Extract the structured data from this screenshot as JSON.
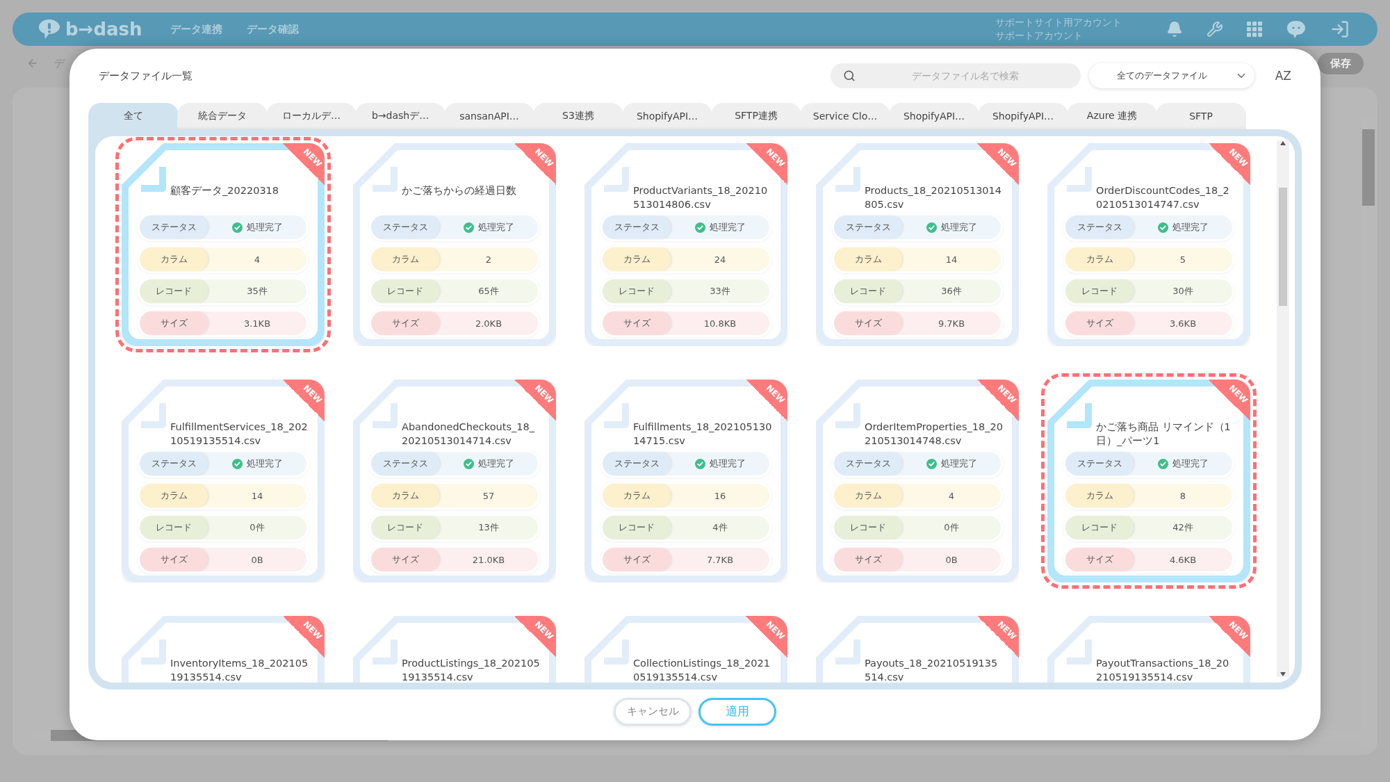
{
  "header": {
    "logo": "b→dash",
    "nav": [
      "データ連携",
      "データ確認"
    ],
    "account": [
      "サポートサイト用アカウント",
      "サポートアカウント"
    ]
  },
  "subbar": {
    "breadcrumb": "デ",
    "save": "保存"
  },
  "modal": {
    "title": "データファイル一覧",
    "search": {
      "placeholder": "データファイル名で検索"
    },
    "filter": {
      "value": "全てのデータファイル"
    },
    "sort": "AZ",
    "tabs": [
      {
        "label": "全て",
        "selected": true
      },
      {
        "label": "統合データ",
        "selected": false
      },
      {
        "label": "ローカルデ…",
        "selected": false
      },
      {
        "label": "b→dashデ…",
        "selected": false
      },
      {
        "label": "sansanAPI…",
        "selected": false
      },
      {
        "label": "S3連携",
        "selected": false
      },
      {
        "label": "ShopifyAPI…",
        "selected": false
      },
      {
        "label": "SFTP連携",
        "selected": false
      },
      {
        "label": "Service Clo…",
        "selected": false
      },
      {
        "label": "ShopifyAPI…",
        "selected": false
      },
      {
        "label": "ShopifyAPI…",
        "selected": false
      },
      {
        "label": "Azure 連携",
        "selected": false
      },
      {
        "label": "SFTP",
        "selected": false
      }
    ],
    "cards": [
      {
        "name": "顧客データ_20220318",
        "badge": "NEW",
        "selected": true,
        "stats": [
          {
            "kind": "status",
            "label": "ステータス",
            "value": "処理完了"
          },
          {
            "kind": "column",
            "label": "カラム",
            "value": "4"
          },
          {
            "kind": "record",
            "label": "レコード",
            "value": "35件"
          },
          {
            "kind": "size",
            "label": "サイズ",
            "value": "3.1KB"
          }
        ]
      },
      {
        "name": "かご落ちからの経過日数",
        "badge": "NEW",
        "selected": false,
        "stats": [
          {
            "kind": "status",
            "label": "ステータス",
            "value": "処理完了"
          },
          {
            "kind": "column",
            "label": "カラム",
            "value": "2"
          },
          {
            "kind": "record",
            "label": "レコード",
            "value": "65件"
          },
          {
            "kind": "size",
            "label": "サイズ",
            "value": "2.0KB"
          }
        ]
      },
      {
        "name": "ProductVariants_18_20210513014806.csv",
        "badge": "NEW",
        "selected": false,
        "stats": [
          {
            "kind": "status",
            "label": "ステータス",
            "value": "処理完了"
          },
          {
            "kind": "column",
            "label": "カラム",
            "value": "24"
          },
          {
            "kind": "record",
            "label": "レコード",
            "value": "33件"
          },
          {
            "kind": "size",
            "label": "サイズ",
            "value": "10.8KB"
          }
        ]
      },
      {
        "name": "Products_18_20210513014805.csv",
        "badge": "NEW",
        "selected": false,
        "stats": [
          {
            "kind": "status",
            "label": "ステータス",
            "value": "処理完了"
          },
          {
            "kind": "column",
            "label": "カラム",
            "value": "14"
          },
          {
            "kind": "record",
            "label": "レコード",
            "value": "36件"
          },
          {
            "kind": "size",
            "label": "サイズ",
            "value": "9.7KB"
          }
        ]
      },
      {
        "name": "OrderDiscountCodes_18_20210513014747.csv",
        "badge": "NEW",
        "selected": false,
        "stats": [
          {
            "kind": "status",
            "label": "ステータス",
            "value": "処理完了"
          },
          {
            "kind": "column",
            "label": "カラム",
            "value": "5"
          },
          {
            "kind": "record",
            "label": "レコード",
            "value": "30件"
          },
          {
            "kind": "size",
            "label": "サイズ",
            "value": "3.6KB"
          }
        ]
      },
      {
        "name": "FulfillmentServices_18_20210519135514.csv",
        "badge": "NEW",
        "selected": false,
        "stats": [
          {
            "kind": "status",
            "label": "ステータス",
            "value": "処理完了"
          },
          {
            "kind": "column",
            "label": "カラム",
            "value": "14"
          },
          {
            "kind": "record",
            "label": "レコード",
            "value": "0件"
          },
          {
            "kind": "size",
            "label": "サイズ",
            "value": "0B"
          }
        ]
      },
      {
        "name": "AbandonedCheckouts_18_20210513014714.csv",
        "badge": "NEW",
        "selected": false,
        "stats": [
          {
            "kind": "status",
            "label": "ステータス",
            "value": "処理完了"
          },
          {
            "kind": "column",
            "label": "カラム",
            "value": "57"
          },
          {
            "kind": "record",
            "label": "レコード",
            "value": "13件"
          },
          {
            "kind": "size",
            "label": "サイズ",
            "value": "21.0KB"
          }
        ]
      },
      {
        "name": "Fulfillments_18_20210513014715.csv",
        "badge": "NEW",
        "selected": false,
        "stats": [
          {
            "kind": "status",
            "label": "ステータス",
            "value": "処理完了"
          },
          {
            "kind": "column",
            "label": "カラム",
            "value": "16"
          },
          {
            "kind": "record",
            "label": "レコード",
            "value": "4件"
          },
          {
            "kind": "size",
            "label": "サイズ",
            "value": "7.7KB"
          }
        ]
      },
      {
        "name": "OrderItemProperties_18_20210513014748.csv",
        "badge": "NEW",
        "selected": false,
        "stats": [
          {
            "kind": "status",
            "label": "ステータス",
            "value": "処理完了"
          },
          {
            "kind": "column",
            "label": "カラム",
            "value": "4"
          },
          {
            "kind": "record",
            "label": "レコード",
            "value": "0件"
          },
          {
            "kind": "size",
            "label": "サイズ",
            "value": "0B"
          }
        ]
      },
      {
        "name": "かご落ち商品 リマインド（1日）_パーツ1",
        "badge": "NEW",
        "selected": true,
        "stats": [
          {
            "kind": "status",
            "label": "ステータス",
            "value": "処理完了"
          },
          {
            "kind": "column",
            "label": "カラム",
            "value": "8"
          },
          {
            "kind": "record",
            "label": "レコード",
            "value": "42件"
          },
          {
            "kind": "size",
            "label": "サイズ",
            "value": "4.6KB"
          }
        ]
      },
      {
        "name": "InventoryItems_18_20210519135514.csv",
        "badge": "NEW",
        "selected": false
      },
      {
        "name": "ProductListings_18_20210519135514.csv",
        "badge": "NEW",
        "selected": false
      },
      {
        "name": "CollectionListings_18_20210519135514.csv",
        "badge": "NEW",
        "selected": false
      },
      {
        "name": "Payouts_18_20210519135514.csv",
        "badge": "NEW",
        "selected": false
      },
      {
        "name": "PayoutTransactions_18_20210519135514.csv",
        "badge": "NEW",
        "selected": false
      }
    ],
    "buttons": {
      "cancel": "キャンセル",
      "apply": "適用"
    }
  }
}
